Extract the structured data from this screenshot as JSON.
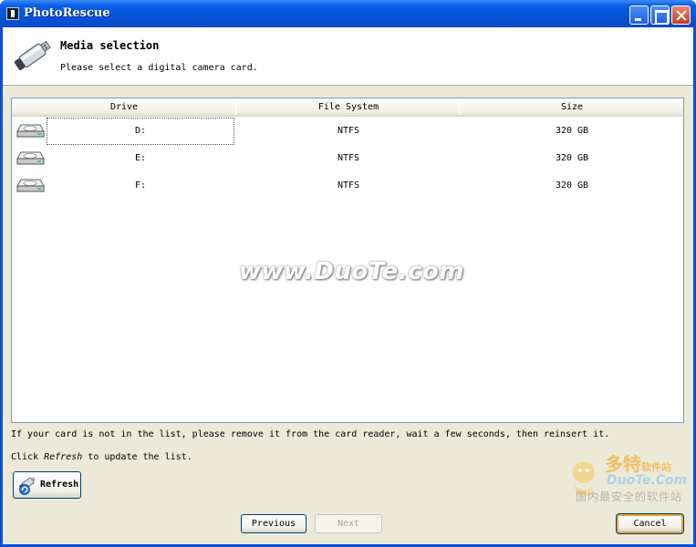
{
  "window": {
    "title": "PhotoRescue"
  },
  "header": {
    "title": "Media selection",
    "subtitle": "Please select a digital camera card."
  },
  "table": {
    "columns": [
      "Drive",
      "File System",
      "Size"
    ],
    "rows": [
      {
        "drive": "D:",
        "fs": "NTFS",
        "size": "320 GB"
      },
      {
        "drive": "E:",
        "fs": "NTFS",
        "size": "320 GB"
      },
      {
        "drive": "F:",
        "fs": "NTFS",
        "size": "320 GB"
      }
    ]
  },
  "watermark": {
    "text": "www.DuoTe.com"
  },
  "info": {
    "line1": "If your card is not in the list, please remove it from the card reader, wait a few seconds, then reinsert it.",
    "line2_prefix": "Click ",
    "line2_em": "Refresh",
    "line2_suffix": " to update the list."
  },
  "buttons": {
    "refresh": "Refresh",
    "previous": "Previous",
    "next": "Next",
    "cancel": "Cancel"
  },
  "logo_watermark": {
    "brand": "多特",
    "brand_small": "软件站",
    "domain": "DuoTe.Com",
    "tagline": "国内最安全的软件站"
  }
}
